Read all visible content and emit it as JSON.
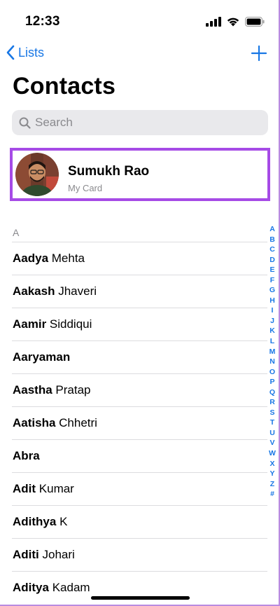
{
  "status_bar": {
    "time": "12:33",
    "icons": [
      "signal-icon",
      "wifi-icon",
      "battery-icon"
    ]
  },
  "nav": {
    "back_label": "Lists",
    "back_icon": "chevron-left-icon",
    "add_icon": "plus-icon"
  },
  "page": {
    "title": "Contacts"
  },
  "search": {
    "placeholder": "Search",
    "value": ""
  },
  "my_card": {
    "name": "Sumukh Rao",
    "subtitle": "My Card"
  },
  "contacts": {
    "section": "A",
    "items": [
      {
        "first": "Aadya",
        "last": " Mehta"
      },
      {
        "first": "Aakash",
        "last": " Jhaveri"
      },
      {
        "first": "Aamir",
        "last": " Siddiqui"
      },
      {
        "first": "Aaryaman",
        "last": ""
      },
      {
        "first": "Aastha",
        "last": " Pratap"
      },
      {
        "first": "Aatisha",
        "last": " Chhetri"
      },
      {
        "first": "Abra",
        "last": ""
      },
      {
        "first": "Adit",
        "last": " Kumar"
      },
      {
        "first": "Adithya",
        "last": " K"
      },
      {
        "first": "Aditi",
        "last": " Johari"
      },
      {
        "first": "Aditya",
        "last": " Kadam"
      }
    ]
  },
  "index_letters": [
    "A",
    "B",
    "C",
    "D",
    "E",
    "F",
    "G",
    "H",
    "I",
    "J",
    "K",
    "L",
    "M",
    "N",
    "O",
    "P",
    "Q",
    "R",
    "S",
    "T",
    "U",
    "V",
    "W",
    "X",
    "Y",
    "Z",
    "#"
  ],
  "colors": {
    "accent": "#1877e5",
    "highlight": "#a64be6",
    "secondary_text": "#8a8a8e",
    "search_bg": "#e9e9ec"
  }
}
